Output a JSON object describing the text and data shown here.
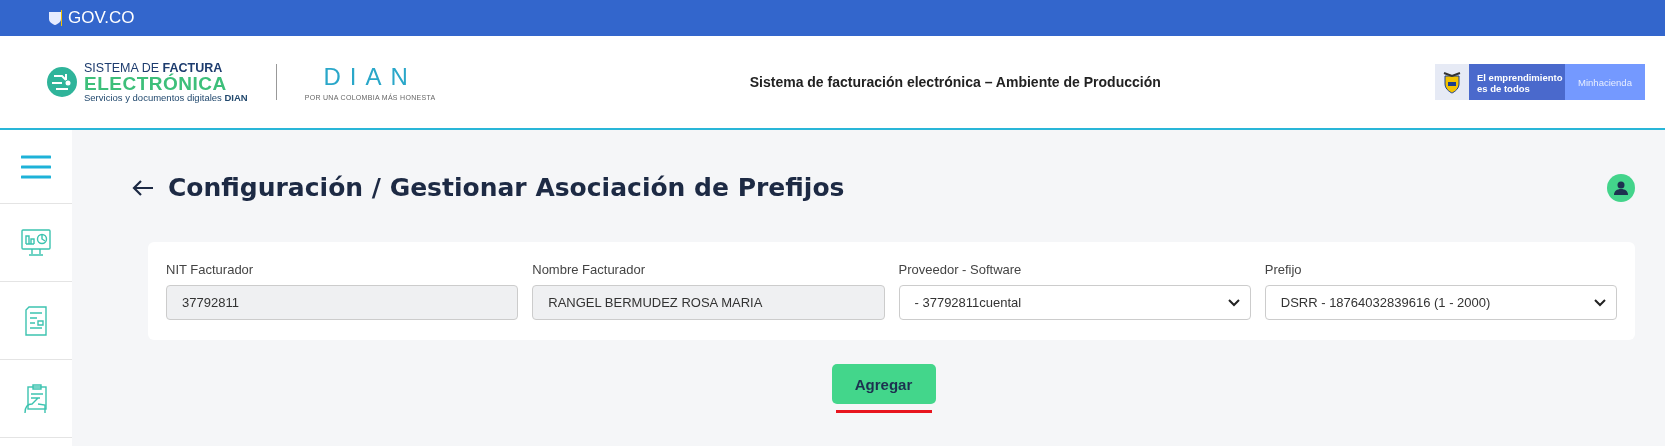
{
  "gov_bar": {
    "label": "GOV.CO"
  },
  "header": {
    "brand": {
      "line1": "SISTEMA DE **FACTURA**",
      "line2": "ELECTRÓNICA",
      "line3": "Servicios y documentos digitales **DIAN**"
    },
    "agency": {
      "name": "DIAN",
      "motto": "POR UNA COLOMBIA MÁS HONESTA"
    },
    "title": "Sistema de facturación electrónica – Ambiente de Producción",
    "ministry": {
      "slogan": "El emprendimiento es de todos",
      "name": "Minhacienda"
    }
  },
  "sidebar": {
    "items": [
      {
        "kind": "menu"
      },
      {
        "kind": "dashboard"
      },
      {
        "kind": "document"
      },
      {
        "kind": "clipboard"
      }
    ]
  },
  "page": {
    "title": "Configuración / Gestionar Asociación de Prefijos"
  },
  "form": {
    "fields": [
      {
        "label": "NIT Facturador",
        "value": "37792811",
        "kind": "readonly"
      },
      {
        "label": "Nombre Facturador",
        "value": "RANGEL BERMUDEZ ROSA MARIA",
        "kind": "readonly"
      },
      {
        "label": "Proveedor - Software",
        "value": "- 37792811cuental",
        "kind": "select"
      },
      {
        "label": "Prefijo",
        "value": "DSRR - 18764032839616 (1 - 2000)",
        "kind": "select"
      }
    ]
  },
  "buttons": [
    {
      "label": "Agregar"
    }
  ]
}
